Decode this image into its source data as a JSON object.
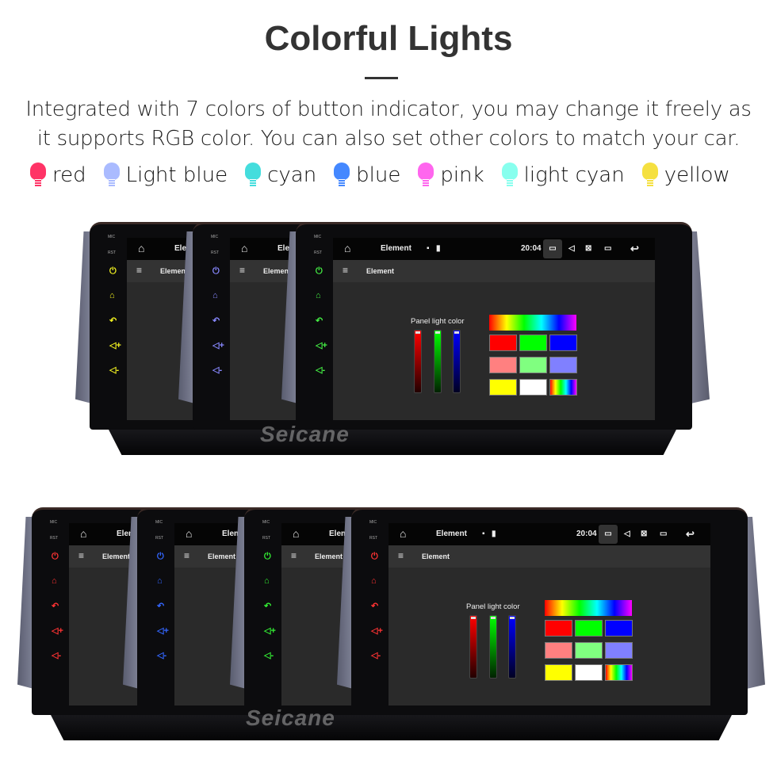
{
  "header": {
    "title": "Colorful Lights",
    "description_line1": "Integrated with 7 colors of button indicator, you may change it freely as",
    "description_line2": "it supports RGB color. You can also set other colors to match your car."
  },
  "legend": [
    {
      "label": "red",
      "color": "#ff3366"
    },
    {
      "label": "Light blue",
      "color": "#aabbff"
    },
    {
      "label": "cyan",
      "color": "#44dddd"
    },
    {
      "label": "blue",
      "color": "#4488ff"
    },
    {
      "label": "pink",
      "color": "#ff66ee"
    },
    {
      "label": "light cyan",
      "color": "#88ffee"
    },
    {
      "label": "yellow",
      "color": "#f5e040"
    }
  ],
  "device": {
    "mic": "MIC",
    "rst": "RST",
    "app_title": "Element",
    "time": "20:04",
    "panel_label": "Panel light color",
    "side_icons": [
      "power-icon",
      "home-icon",
      "back-icon",
      "volume-up-icon",
      "volume-down-icon"
    ],
    "swatches": [
      "#ff0000",
      "#00ff00",
      "#0000ff",
      "#ff8080",
      "#80ff80",
      "#8080ff",
      "#ffff00",
      "#ffffff",
      "rainbow"
    ]
  },
  "watermark": "Seicane",
  "rows": [
    {
      "units": [
        {
          "accent": "#f0f020"
        },
        {
          "accent": "#8888ff"
        },
        {
          "accent": "#44ee44"
        }
      ]
    },
    {
      "units": [
        {
          "accent": "#ff3333"
        },
        {
          "accent": "#3366ff"
        },
        {
          "accent": "#33ee33"
        },
        {
          "accent": "#ff3333"
        }
      ]
    }
  ]
}
